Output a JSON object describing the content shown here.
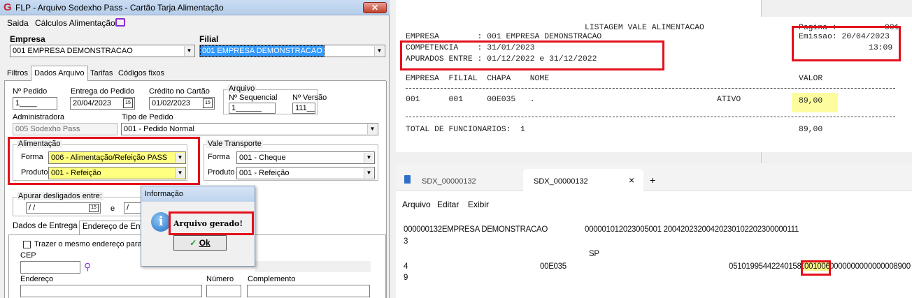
{
  "window": {
    "title": "FLP - Arquivo Sodexho Pass - Cartão Tarja Alimentação",
    "close_label": "✕",
    "menu": [
      "Saida",
      "Cálculos Alimentação"
    ]
  },
  "form": {
    "empresa_label": "Empresa",
    "empresa_value": "001 EMPRESA DEMONSTRACAO",
    "filial_label": "Filial",
    "filial_value": "001 EMPRESA DEMONSTRACAO",
    "tabs": [
      "Filtros",
      "Dados Arquivo",
      "Tarifas",
      "Códigos fixos"
    ],
    "pedido_label": "Nº Pedido",
    "pedido_value": "1____",
    "entrega_label": "Entrega do Pedido",
    "entrega_value": "20/04/2023",
    "credito_label": "Crédito no Cartão",
    "credito_value": "01/02/2023",
    "arquivo_group": "Arquivo",
    "sequencial_label": "Nº Sequencial",
    "sequencial_value": "1______",
    "versao_label": "Nº Versão",
    "versao_value": "111__",
    "administradora_label": "Administradora",
    "administradora_value": "005 Sodexho Pass",
    "tipo_pedido_label": "Tipo de Pedido",
    "tipo_pedido_value": "001 - Pedido Normal",
    "alimentacao_group": "Alimentação",
    "forma_label": "Forma",
    "alim_forma_value": "006 - Alimentação/Refeição PASS",
    "produto_label": "Produto",
    "alim_produto_value": "001 - Refeição",
    "vt_group": "Vale Transporte",
    "vt_forma_value": "001 - Cheque",
    "vt_produto_value": "001 - Refeição",
    "apurar_label": "Apurar desligados entre:",
    "apurar_from": " / /",
    "apurar_e": "e",
    "apurar_to": " /",
    "sub_tabs": [
      "Dados de Entrega",
      "Endereço de Entre"
    ],
    "trazer_label": "Trazer o mesmo endereço para tod",
    "cep_label": "CEP",
    "endereco_label": "Endereço",
    "numero_label": "Número",
    "complemento_label": "Complemento"
  },
  "dialog": {
    "title": "Informação",
    "icon": "i",
    "message": "Arquivo gerado!",
    "ok_label": "Ok"
  },
  "report": {
    "title": "LISTAGEM VALE ALIMENTACAO",
    "pagina": "Pagina :          001",
    "empresa": "EMPRESA        : 001 EMPRESA DEMONSTRACAO",
    "emissao": "Emissao: 20/04/2023",
    "hora": "13:09",
    "competencia": "COMPETENCIA    : 31/01/2023",
    "apurados": "APURADOS ENTRE : 01/12/2022 e 31/12/2022",
    "columns": "EMPRESA  FILIAL  CHAPA    NOME",
    "valor_col": "VALOR",
    "row": "001      001     00E035   .",
    "row_status": "ATIVO",
    "row_valor": "89,00",
    "total": "TOTAL DE FUNCIONARIOS:  1",
    "total_valor": "89,00"
  },
  "notepad": {
    "tab1": "SDX_00000132",
    "tab2": "SDX_00000132",
    "close": "×",
    "add": "+",
    "menu": [
      "Arquivo",
      "Editar",
      "Exibir"
    ],
    "line1a": "000000132EMPRESA DEMONSTRACAO",
    "line1b": "000001012023005001 20042023200420230102202300000111",
    "line2": "3",
    "line3": "SP",
    "line4a": "4",
    "line4b": "00E035",
    "line4c": "0510199544224015803",
    "line4hl": "001006",
    "line4d": "0000000000000008900",
    "line5": "9"
  }
}
